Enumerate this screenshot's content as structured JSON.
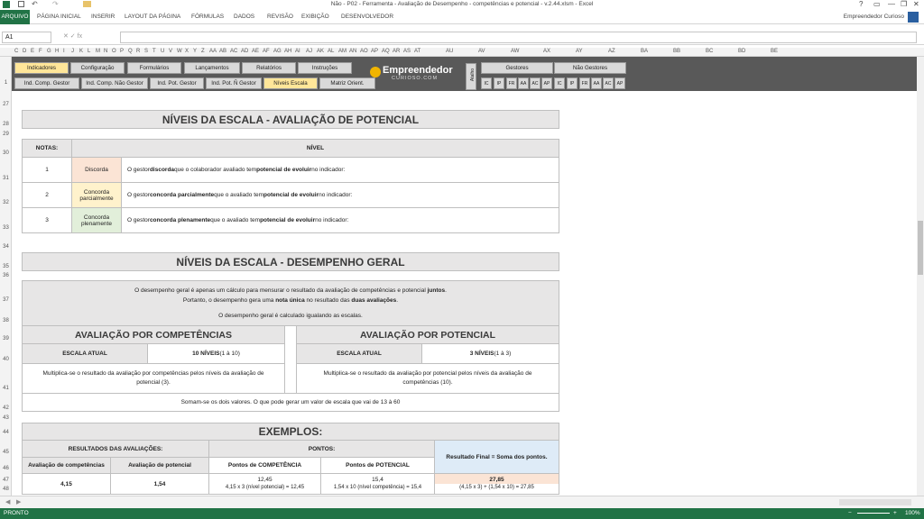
{
  "window": {
    "title": "Não - P02 - Ferramenta - Avaliação de Desempenho - competências e potencial - v.2.44.xlsm - Excel",
    "controls": [
      "?",
      "▭",
      "—",
      "❐",
      "✕"
    ]
  },
  "ribbon": {
    "file_tab": "ARQUIVO",
    "tabs": [
      "PÁGINA INICIAL",
      "INSERIR",
      "LAYOUT DA PÁGINA",
      "FÓRMULAS",
      "DADOS",
      "REVISÃO",
      "EXIBIÇÃO",
      "DESENVOLVEDOR"
    ],
    "user": "Empreendedor Curioso"
  },
  "formula_bar": {
    "name_box": "A1",
    "fx_icons": "✕  ✓  fx"
  },
  "columns": [
    "C",
    "D",
    "E",
    "F",
    "G",
    "H",
    "I",
    "J",
    "K",
    "L",
    "M",
    "N",
    "O",
    "P",
    "Q",
    "R",
    "S",
    "T",
    "U",
    "V",
    "W",
    "X",
    "Y",
    "Z",
    "AA",
    "AB",
    "AC",
    "AD",
    "AE",
    "AF",
    "AG",
    "AH",
    "AI",
    "AJ",
    "AK",
    "AL",
    "AM",
    "AN",
    "AO",
    "AP",
    "AQ",
    "AR",
    "AS",
    "AT",
    "AU",
    "AV",
    "AW",
    "AX",
    "AY",
    "AZ",
    "BA",
    "BB",
    "BC",
    "BD",
    "BE"
  ],
  "rows": [
    "1",
    "27",
    "28",
    "29",
    "30",
    "31",
    "32",
    "33",
    "34",
    "35",
    "36",
    "37",
    "38",
    "39",
    "40",
    "41",
    "42",
    "43",
    "44",
    "45",
    "46",
    "47",
    "48"
  ],
  "nav": {
    "row1": [
      "Indicadores",
      "Configuração",
      "Formulários",
      "Lançamentos",
      "Relatórios",
      "Instruções"
    ],
    "row2": [
      "Ind. Comp. Gestor",
      "Ind. Comp. Não Gestor",
      "Ind. Pot. Gestor",
      "Ind. Pot. Ñ Gestor",
      "Níveis Escala",
      "Matriz Orient."
    ],
    "logo_main": "Empreendedor",
    "logo_sub": "CURIOSO.COM",
    "shortcut": "Atalho",
    "gestores": "Gestores",
    "nao_gestores": "Não Gestores",
    "small": [
      "IC",
      "IP",
      "FR",
      "AA",
      "AC",
      "AP",
      "IC",
      "IP",
      "FR",
      "AA",
      "AC",
      "AP"
    ]
  },
  "potencial": {
    "title": "NÍVEIS DA ESCALA - AVALIAÇÃO DE POTENCIAL",
    "col_notas": "NOTAS:",
    "col_nivel": "NÍVEL",
    "rows": [
      {
        "nota": "1",
        "label": "Discorda",
        "color": "#fbe4d5",
        "pre": "O gestor ",
        "b1": "discorda",
        "mid": " que o colaborador avaliado tem ",
        "b2": "potencial de evoluir",
        "post": " no indicador:"
      },
      {
        "nota": "2",
        "label": "Concorda parcialmente",
        "color": "#fff2cc",
        "pre": "O gestor ",
        "b1": "concorda parcialmente",
        "mid": " que o avaliado tem ",
        "b2": "potencial de evoluir",
        "post": " no indicador:"
      },
      {
        "nota": "3",
        "label": "Concorda plenamente",
        "color": "#e2efda",
        "pre": "O gestor ",
        "b1": "concorda plenamente",
        "mid": " que o avaliado tem ",
        "b2": "potencial de evoluir",
        "post": " no indicador:"
      }
    ]
  },
  "desempenho": {
    "title": "NÍVEIS DA ESCALA - DESEMPENHO GERAL",
    "intro1_a": "O desempenho geral é apenas um cálculo para mensurar o resultado da avaliação de competências e potencial ",
    "intro1_b": "juntos",
    "intro1_c": ".",
    "intro2_a": "Portanto, o desempenho gera uma ",
    "intro2_b": "nota única",
    "intro2_c": " no resultado das ",
    "intro2_d": "duas avaliações",
    "intro2_e": ".",
    "intro3": "O desempenho geral é calculado igualando as escalas.",
    "comp_title": "AVALIAÇÃO POR COMPETÊNCIAS",
    "pot_title": "AVALIAÇÃO POR POTENCIAL",
    "escala_atual": "ESCALA ATUAL",
    "comp_levels_b": "10 NÍVEIS",
    "comp_levels_r": " (1 à 10)",
    "pot_levels_b": "3 NÍVEIS",
    "pot_levels_r": " (1 à 3)",
    "comp_text": "Multiplica-se o resultado da avaliação por competências pelos níveis da avaliação de potencial (3).",
    "pot_text": "Multiplica-se o resultado da avaliação por potencial pelos níveis da avaliação de competências (10).",
    "sum_text": "Somam-se os dois valores. O que pode gerar um valor de escala que vai de 13 à 60"
  },
  "exemplos": {
    "title": "EXEMPLOS:",
    "results_hdr": "RESULTADOS DAS AVALIAÇÕES:",
    "points_hdr": "PONTOS:",
    "final_hdr": "Resultado Final = Soma dos pontos.",
    "c1": "Avaliação de competências",
    "c2": "Avaliação de potencial",
    "c3": "Pontos de COMPETÊNCIA",
    "c4": "Pontos de POTENCIAL",
    "v1": "4,15",
    "v2": "1,54",
    "v3": "12,45",
    "v3_note": "4,15 x 3 (nível potencial) = 12,45",
    "v4": "15,4",
    "v4_note": "1,54 x 10 (nível competência) = 15,4",
    "v5": "27,85",
    "v5_note": "(4,15 x 3) + (1,54 x 10) = 27,85"
  },
  "status": {
    "ready": "PRONTO",
    "zoom": "100%"
  }
}
